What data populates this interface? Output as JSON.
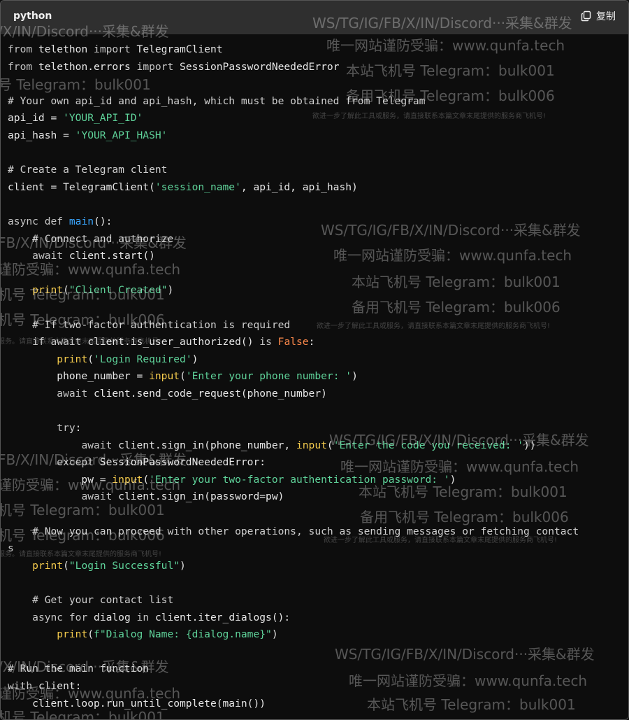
{
  "header": {
    "language": "python",
    "copy_label": "复制",
    "copy_icon": "copy-icon"
  },
  "code_lines": [
    [
      {
        "t": "from",
        "c": "kw"
      },
      {
        "t": " telethon ",
        "c": ""
      },
      {
        "t": "import",
        "c": "kw"
      },
      {
        "t": " TelegramClient",
        "c": ""
      }
    ],
    [
      {
        "t": "from",
        "c": "kw"
      },
      {
        "t": " telethon.errors ",
        "c": ""
      },
      {
        "t": "import",
        "c": "kw"
      },
      {
        "t": " SessionPasswordNeededError",
        "c": ""
      }
    ],
    [],
    [
      {
        "t": "# Your own api_id and api_hash, which must be obtained from Telegram",
        "c": "cmt"
      }
    ],
    [
      {
        "t": "api_id = ",
        "c": ""
      },
      {
        "t": "'YOUR_API_ID'",
        "c": "str"
      }
    ],
    [
      {
        "t": "api_hash = ",
        "c": ""
      },
      {
        "t": "'YOUR_API_HASH'",
        "c": "str"
      }
    ],
    [],
    [
      {
        "t": "# Create a Telegram client",
        "c": "cmt"
      }
    ],
    [
      {
        "t": "client = TelegramClient(",
        "c": ""
      },
      {
        "t": "'session_name'",
        "c": "str"
      },
      {
        "t": ", api_id, api_hash)",
        "c": ""
      }
    ],
    [],
    [
      {
        "t": "async",
        "c": "kw"
      },
      {
        "t": " ",
        "c": ""
      },
      {
        "t": "def",
        "c": "kw"
      },
      {
        "t": " ",
        "c": ""
      },
      {
        "t": "main",
        "c": "fn"
      },
      {
        "t": "():",
        "c": ""
      }
    ],
    [
      {
        "t": "    ",
        "c": ""
      },
      {
        "t": "# Connect and authorize",
        "c": "cmt"
      }
    ],
    [
      {
        "t": "    ",
        "c": ""
      },
      {
        "t": "await",
        "c": "kw"
      },
      {
        "t": " client.start()",
        "c": ""
      }
    ],
    [],
    [
      {
        "t": "    ",
        "c": ""
      },
      {
        "t": "print",
        "c": "bi"
      },
      {
        "t": "(",
        "c": ""
      },
      {
        "t": "\"Client Created\"",
        "c": "str"
      },
      {
        "t": ")",
        "c": ""
      }
    ],
    [],
    [
      {
        "t": "    ",
        "c": ""
      },
      {
        "t": "# If two-factor authentication is required",
        "c": "cmt"
      }
    ],
    [
      {
        "t": "    ",
        "c": ""
      },
      {
        "t": "if",
        "c": "kw"
      },
      {
        "t": " ",
        "c": ""
      },
      {
        "t": "await",
        "c": "kw"
      },
      {
        "t": " client.is_user_authorized() ",
        "c": ""
      },
      {
        "t": "is",
        "c": "kw"
      },
      {
        "t": " ",
        "c": ""
      },
      {
        "t": "False",
        "c": "bool"
      },
      {
        "t": ":",
        "c": ""
      }
    ],
    [
      {
        "t": "        ",
        "c": ""
      },
      {
        "t": "print",
        "c": "bi"
      },
      {
        "t": "(",
        "c": ""
      },
      {
        "t": "'Login Required'",
        "c": "str"
      },
      {
        "t": ")",
        "c": ""
      }
    ],
    [
      {
        "t": "        phone_number = ",
        "c": ""
      },
      {
        "t": "input",
        "c": "bi"
      },
      {
        "t": "(",
        "c": ""
      },
      {
        "t": "'Enter your phone number: '",
        "c": "str"
      },
      {
        "t": ")",
        "c": ""
      }
    ],
    [
      {
        "t": "        ",
        "c": ""
      },
      {
        "t": "await",
        "c": "kw"
      },
      {
        "t": " client.send_code_request(phone_number)",
        "c": ""
      }
    ],
    [],
    [
      {
        "t": "        ",
        "c": ""
      },
      {
        "t": "try",
        "c": "kw"
      },
      {
        "t": ":",
        "c": ""
      }
    ],
    [
      {
        "t": "            ",
        "c": ""
      },
      {
        "t": "await",
        "c": "kw"
      },
      {
        "t": " client.sign_in(phone_number, ",
        "c": ""
      },
      {
        "t": "input",
        "c": "bi"
      },
      {
        "t": "(",
        "c": ""
      },
      {
        "t": "'Enter the code you received: '",
        "c": "str"
      },
      {
        "t": "))",
        "c": ""
      }
    ],
    [
      {
        "t": "        ",
        "c": ""
      },
      {
        "t": "except",
        "c": "kw"
      },
      {
        "t": " SessionPasswordNeededError:",
        "c": ""
      }
    ],
    [
      {
        "t": "            pw = ",
        "c": ""
      },
      {
        "t": "input",
        "c": "bi"
      },
      {
        "t": "(",
        "c": ""
      },
      {
        "t": "'Enter your two-factor authentication password: '",
        "c": "str"
      },
      {
        "t": ")",
        "c": ""
      }
    ],
    [
      {
        "t": "            ",
        "c": ""
      },
      {
        "t": "await",
        "c": "kw"
      },
      {
        "t": " client.sign_in(password=pw)",
        "c": ""
      }
    ],
    [],
    [
      {
        "t": "    ",
        "c": ""
      },
      {
        "t": "# Now you can proceed with other operations, such as sending messages or fetching contact",
        "c": "cmt"
      }
    ],
    [
      {
        "t": "s",
        "c": "cmt"
      }
    ],
    [
      {
        "t": "    ",
        "c": ""
      },
      {
        "t": "print",
        "c": "bi"
      },
      {
        "t": "(",
        "c": ""
      },
      {
        "t": "\"Login Successful\"",
        "c": "str"
      },
      {
        "t": ")",
        "c": ""
      }
    ],
    [],
    [
      {
        "t": "    ",
        "c": ""
      },
      {
        "t": "# Get your contact list",
        "c": "cmt"
      }
    ],
    [
      {
        "t": "    ",
        "c": ""
      },
      {
        "t": "async",
        "c": "kw"
      },
      {
        "t": " ",
        "c": ""
      },
      {
        "t": "for",
        "c": "kw"
      },
      {
        "t": " dialog ",
        "c": ""
      },
      {
        "t": "in",
        "c": "kw"
      },
      {
        "t": " client.iter_dialogs():",
        "c": ""
      }
    ],
    [
      {
        "t": "        ",
        "c": ""
      },
      {
        "t": "print",
        "c": "bi"
      },
      {
        "t": "(",
        "c": ""
      },
      {
        "t": "f\"Dialog Name: {dialog.name}\"",
        "c": "str"
      },
      {
        "t": ")",
        "c": ""
      }
    ],
    [],
    [
      {
        "t": "# Run the main function",
        "c": "cmt"
      }
    ],
    [
      {
        "t": "with",
        "c": "kw"
      },
      {
        "t": " client:",
        "c": ""
      }
    ],
    [
      {
        "t": "    client.loop.run_until_complete(main())",
        "c": ""
      }
    ]
  ],
  "watermark": {
    "line1": "WS/TG/IG/FB/X/IN/Discord···采集&群发",
    "line2": "唯一网站谨防受骗：www.qunfa.tech",
    "line3": "本站飞机号 Telegram：bulk001",
    "line4": "备用飞机号 Telegram：bulk006",
    "line5": "欲进一步了解此工具或服务，请直接联系本篇文章末尾提供的服务商飞机号!",
    "frag_a": "/X/IN/Discord···采集&群发",
    "frag_b": "号 Telegram：bulk001",
    "frag_c": "FB/X/IN/Discord···采集&群发",
    "frag_d": "谨防受骗：www.qunfa.tech",
    "frag_e": "机号 Telegram：bulk001",
    "frag_f": "机号 Telegram：bulk006",
    "frag_g": "服务。请直接联系本篇文章末尾提供的服务商飞机号!"
  }
}
